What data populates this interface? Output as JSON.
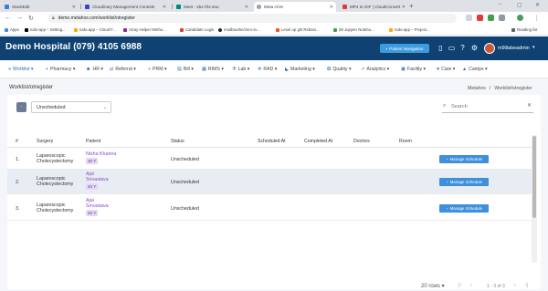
{
  "browser": {
    "tabs": [
      {
        "title": "StackEdit",
        "color": "#3b7dd8"
      },
      {
        "title": "Cloudinary Management Console",
        "color": "#3448c5"
      },
      {
        "title": "Meet - xbz-rfrx-sou",
        "color": "#00897b"
      },
      {
        "title": "Meta AOS",
        "color": "#9aa0a6"
      },
      {
        "title": "MP4 to GIF | CloudConvert",
        "color": "#e53935"
      }
    ],
    "url": "demo.metahos.com/worklist/otregister",
    "bookmarks": [
      {
        "label": "Apps",
        "color": "#4285f4"
      },
      {
        "label": "todo-app – Setting...",
        "color": "#000000"
      },
      {
        "label": "todo-app – Cloud F...",
        "color": "#f9ab00"
      },
      {
        "label": "Array Helper Metho...",
        "color": "#8e24aa"
      },
      {
        "label": "Candidate Login",
        "color": "#e53935"
      },
      {
        "label": "modbourke/zero-to...",
        "color": "#24292e"
      },
      {
        "label": "Level up git! Rebasi...",
        "color": "#f4511e"
      },
      {
        "label": "28 Jupyter Notebo...",
        "color": "#43a047"
      },
      {
        "label": "todo-app – Project...",
        "color": "#f9ab00"
      }
    ],
    "reading_list": "Reading list"
  },
  "header": {
    "hospital": "Demo Hospital (079) 4105 6988",
    "patient_nav": "Patient Navigation",
    "username": "m9lilabeadmin"
  },
  "menu": [
    {
      "label": "Worklist",
      "active": true
    },
    {
      "label": "Pharmacy"
    },
    {
      "label": "HR"
    },
    {
      "label": "Referral"
    },
    {
      "label": "PRM"
    },
    {
      "label": "Bill"
    },
    {
      "label": "RIMS"
    },
    {
      "label": "Lab"
    },
    {
      "label": "RAD"
    },
    {
      "label": "Marketing"
    },
    {
      "label": "Quality"
    },
    {
      "label": "Analytics"
    },
    {
      "label": "Facility"
    },
    {
      "label": "Care"
    },
    {
      "label": "Camps"
    }
  ],
  "page": {
    "title": "Worklist/otregister",
    "breadcrumb": [
      "Metahos",
      "Worklist/otregister"
    ],
    "filter_value": "Unscheduled",
    "search_placeholder": "Search"
  },
  "table": {
    "columns": [
      "#",
      "Surgery",
      "Patient",
      "Status",
      "Scheduled At",
      "Completed At",
      "Doctors",
      "Room"
    ],
    "rows": [
      {
        "num": "1.",
        "surgery1": "Laparoscopic",
        "surgery2": "Cholecystectomy",
        "patient1": "Nisha Khanna",
        "patient2": "",
        "age": "30 Y",
        "status": "Unscheduled",
        "action": "Manage Schedule"
      },
      {
        "num": "2.",
        "surgery1": "Laparoscopic",
        "surgery2": "Cholecystectomy",
        "patient1": "Ajai",
        "patient2": "Srivastava",
        "age": "40 Y",
        "status": "Unscheduled",
        "action": "Manage Schedule"
      },
      {
        "num": "3.",
        "surgery1": "Laparoscopic",
        "surgery2": "Cholecystectomy",
        "patient1": "Ajai",
        "patient2": "Srivastava",
        "age": "40 Y",
        "status": "Unscheduled",
        "action": "Manage Schedule"
      }
    ]
  },
  "pagination": {
    "rows_per_page": "20 rows",
    "range": "1 - 3 of 3"
  }
}
